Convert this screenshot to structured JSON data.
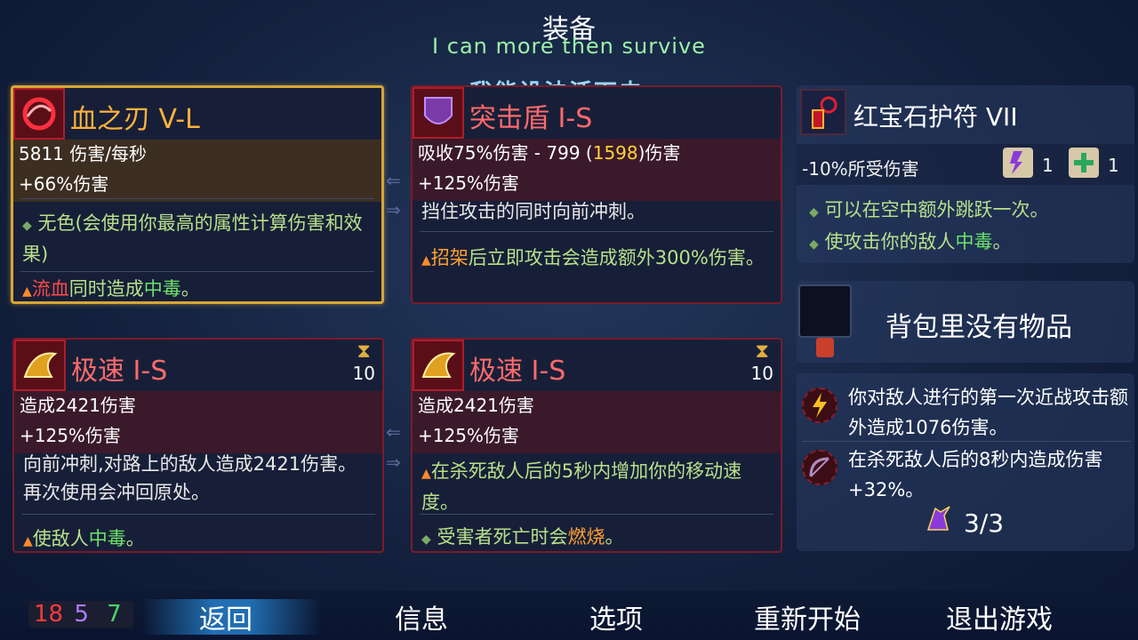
{
  "header": {
    "title": "装备",
    "subtitle": "I can more then survive",
    "overlay": "我能设法活下去"
  },
  "cards": [
    {
      "name": "血之刃 V-L",
      "stat1": "5811 伤害/每秒",
      "stat2": "+66%伤害",
      "desc1": "无色(会使用你最高的属性计算伤害和效果)",
      "desc2_pre": "",
      "desc2_hl1": "流血",
      "desc2_mid": "同时造成",
      "desc2_hl2": "中毒",
      "desc2_post": "。"
    },
    {
      "name": "突击盾 I-S",
      "stat1_pre": "吸收75%伤害 - 799 (",
      "stat1_hl": "1598",
      "stat1_post": ")伤害",
      "stat2": "+125%伤害",
      "desc1": "挡住攻击的同时向前冲刺。",
      "desc2_hl": "招架",
      "desc2": "后立即攻击会造成额外300%伤害。"
    },
    {
      "name": "极速 I-S",
      "counter": "10",
      "stat1": "造成2421伤害",
      "stat2": "+125%伤害",
      "desc1": "向前冲刺,对路上的敌人造成2421伤害。再次使用会冲回原处。",
      "desc2_pre": "使敌人",
      "desc2_hl": "中毒",
      "desc2_post": "。"
    },
    {
      "name": "极速 I-S",
      "counter": "10",
      "stat1": "造成2421伤害",
      "stat2": "+125%伤害",
      "desc1": "在杀死敌人后的5秒内增加你的移动速度。",
      "desc2_pre": "受害者死亡时会",
      "desc2_hl": "燃烧",
      "desc2_post": "。"
    }
  ],
  "amulet": {
    "name": "红宝石护符 VII",
    "stat": "-10%所受伤害",
    "scroll1_count": "1",
    "scroll2_count": "1",
    "effect1": "可以在空中额外跳跃一次。",
    "effect2_pre": "使攻击你的敌人",
    "effect2_hl": "中毒",
    "effect2_post": "。"
  },
  "backpack": {
    "empty_text": "背包里没有物品"
  },
  "abilities": {
    "a1": "你对敌人进行的第一次近战攻击额外造成1076伤害。",
    "a2": "在杀死敌人后的8秒内造成伤害+32%。",
    "charges": "3/3"
  },
  "scrolls": {
    "red": "18",
    "purple": "5",
    "green": "7"
  },
  "nav": {
    "back": "返回",
    "info": "信息",
    "options": "选项",
    "restart": "重新开始",
    "quit": "退出游戏"
  },
  "colors": {
    "red_border": "#7a1b2a",
    "gold_border": "#d6a735",
    "accent_orange": "#ffa030",
    "poison_green": "#6be36b"
  }
}
